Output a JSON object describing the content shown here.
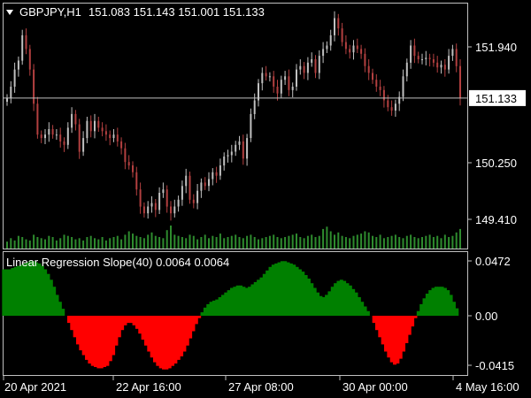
{
  "header": {
    "symbol": "GBPJPY,H1",
    "ohlc": "151.083 151.143 151.001 151.133"
  },
  "price_axis": {
    "ticks": [
      "151.940",
      "150.250",
      "149.410"
    ],
    "current": "151.133"
  },
  "indicator": {
    "title": "Linear Regression Slope(40) 0.0064 0.0064",
    "ticks": [
      "0.0472",
      "0.00",
      "-0.0415"
    ]
  },
  "time_axis": [
    "20 Apr 2021",
    "22 Apr 16:00",
    "27 Apr 08:00",
    "30 Apr 00:00",
    "4 May 16:00"
  ],
  "colors": {
    "background": "#000000",
    "frame": "#c0c0c0",
    "bull_candle": "#c0c0c0",
    "bear_candle": "#b34040",
    "volume": "#2e8b2e",
    "slope_positive": "#008000",
    "slope_negative": "#ff0000",
    "text": "#ffffff"
  },
  "chart_data": [
    {
      "type": "candlestick",
      "title": "GBPJPY,H1",
      "ylim": [
        148.95,
        152.5
      ],
      "closes": [
        151.13,
        151.3,
        151.55,
        151.68,
        152.05,
        151.85,
        151.55,
        151.05,
        150.6,
        150.55,
        150.6,
        150.68,
        150.6,
        150.6,
        150.5,
        150.45,
        150.7,
        150.9,
        150.75,
        150.35,
        150.55,
        150.8,
        150.65,
        150.8,
        150.7,
        150.65,
        150.6,
        150.55,
        150.6,
        150.5,
        150.4,
        150.2,
        150.15,
        150.05,
        149.8,
        149.55,
        149.45,
        149.55,
        149.6,
        149.5,
        149.75,
        149.8,
        149.55,
        149.45,
        149.55,
        149.65,
        149.85,
        150.0,
        149.65,
        149.6,
        149.78,
        149.9,
        149.85,
        149.95,
        150.05,
        150.0,
        150.15,
        150.28,
        150.3,
        150.35,
        150.45,
        150.5,
        150.25,
        150.55,
        150.9,
        151.1,
        151.35,
        151.5,
        151.45,
        151.45,
        151.3,
        151.2,
        151.4,
        151.45,
        151.25,
        151.3,
        151.55,
        151.6,
        151.5,
        151.65,
        151.7,
        151.5,
        151.75,
        151.85,
        151.9,
        152.05,
        152.3,
        152.15,
        151.95,
        151.85,
        151.8,
        151.9,
        151.85,
        151.78,
        151.6,
        151.5,
        151.4,
        151.3,
        151.25,
        151.1,
        151.0,
        150.95,
        151.05,
        151.15,
        151.45,
        151.65,
        151.9,
        151.75,
        151.7,
        151.7,
        151.72,
        151.7,
        151.65,
        151.58,
        151.62,
        151.55,
        151.75,
        151.85,
        151.6,
        151.13
      ],
      "volume": [
        0.3,
        0.45,
        0.35,
        0.55,
        0.5,
        0.4,
        0.35,
        0.6,
        0.5,
        0.45,
        0.4,
        0.55,
        0.5,
        0.35,
        0.45,
        0.6,
        0.55,
        0.5,
        0.4,
        0.45,
        0.35,
        0.5,
        0.55,
        0.45,
        0.4,
        0.5,
        0.35,
        0.45,
        0.5,
        0.55,
        0.4,
        0.6,
        0.75,
        0.65,
        0.55,
        0.5,
        0.45,
        0.6,
        0.7,
        0.55,
        0.5,
        0.45,
        0.8,
        1.0,
        0.6,
        0.55,
        0.5,
        0.45,
        0.6,
        0.55,
        0.4,
        0.5,
        0.6,
        0.45,
        0.55,
        0.5,
        0.65,
        0.45,
        0.5,
        0.55,
        0.6,
        0.5,
        0.45,
        0.55,
        0.6,
        0.5,
        0.4,
        0.45,
        0.5,
        0.55,
        0.6,
        0.5,
        0.45,
        0.5,
        0.55,
        0.6,
        0.65,
        0.5,
        0.45,
        0.55,
        0.6,
        0.5,
        0.55,
        0.85,
        0.95,
        0.75,
        0.6,
        0.7,
        0.55,
        0.5,
        0.45,
        0.55,
        0.6,
        0.65,
        0.75,
        0.7,
        0.55,
        0.5,
        0.6,
        0.45,
        0.5,
        0.55,
        0.6,
        0.5,
        0.45,
        0.55,
        0.6,
        0.5,
        0.45,
        0.5,
        0.55,
        0.6,
        0.5,
        0.55,
        0.45,
        0.6,
        0.5,
        0.55,
        0.7,
        0.85
      ],
      "y_ticks": [
        151.94,
        150.25,
        149.41
      ],
      "current_price": 151.133
    },
    {
      "type": "area",
      "title": "Linear Regression Slope(40) 0.0064 0.0064",
      "ylim": [
        -0.055,
        0.055
      ],
      "y_ticks": [
        0.0472,
        0.0,
        -0.0415
      ],
      "values": [
        0.04,
        0.04,
        0.04,
        0.041,
        0.042,
        0.043,
        0.044,
        0.045,
        0.046,
        0.047,
        0.047,
        0.046,
        0.045,
        0.043,
        0.04,
        0.036,
        0.031,
        0.025,
        0.018,
        0.012,
        0.006,
        0.0,
        -0.006,
        -0.012,
        -0.018,
        -0.024,
        -0.029,
        -0.033,
        -0.037,
        -0.04,
        -0.042,
        -0.043,
        -0.044,
        -0.044,
        -0.043,
        -0.042,
        -0.038,
        -0.033,
        -0.025,
        -0.018,
        -0.012,
        -0.008,
        -0.006,
        -0.006,
        -0.008,
        -0.011,
        -0.015,
        -0.02,
        -0.025,
        -0.03,
        -0.035,
        -0.039,
        -0.042,
        -0.044,
        -0.045,
        -0.045,
        -0.044,
        -0.042,
        -0.04,
        -0.037,
        -0.034,
        -0.03,
        -0.025,
        -0.019,
        -0.013,
        -0.007,
        -0.002,
        0.003,
        0.007,
        0.01,
        0.012,
        0.013,
        0.014,
        0.016,
        0.018,
        0.02,
        0.022,
        0.024,
        0.025,
        0.026,
        0.026,
        0.025,
        0.024,
        0.025,
        0.027,
        0.029,
        0.031,
        0.033,
        0.036,
        0.039,
        0.042,
        0.044,
        0.045,
        0.046,
        0.047,
        0.047,
        0.046,
        0.045,
        0.044,
        0.042,
        0.04,
        0.038,
        0.035,
        0.032,
        0.028,
        0.024,
        0.02,
        0.017,
        0.016,
        0.018,
        0.021,
        0.025,
        0.028,
        0.03,
        0.031,
        0.03,
        0.028,
        0.026,
        0.023,
        0.02,
        0.016,
        0.012,
        0.008,
        0.004,
        0.0,
        -0.006,
        -0.012,
        -0.018,
        -0.024,
        -0.03,
        -0.035,
        -0.039,
        -0.041,
        -0.04,
        -0.036,
        -0.03,
        -0.023,
        -0.016,
        -0.009,
        -0.002,
        0.004,
        0.01,
        0.015,
        0.019,
        0.022,
        0.024,
        0.025,
        0.025,
        0.025,
        0.024,
        0.022,
        0.018,
        0.012,
        0.0064
      ]
    }
  ]
}
